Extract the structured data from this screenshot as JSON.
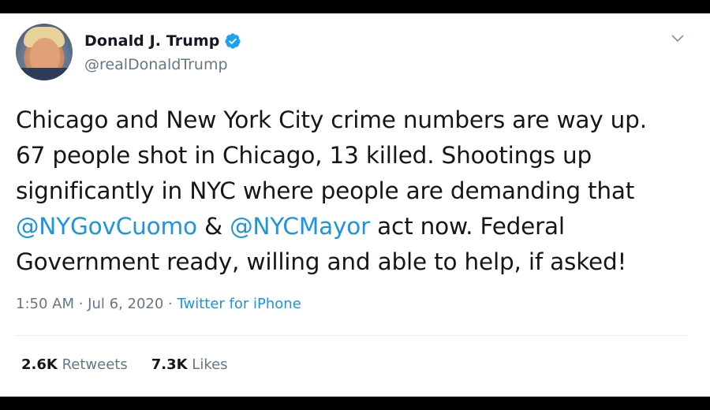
{
  "tweet": {
    "author": {
      "name": "Donald J. Trump",
      "handle": "@realDonaldTrump"
    },
    "text": {
      "line1": "Chicago and New York City crime numbers are way up.",
      "line2": "67 people shot in Chicago, 13 killed. Shootings up",
      "line3": "significantly in NYC where people are demanding that",
      "mention1": "@NYGovCuomo",
      "amp": " & ",
      "mention2": "@NYCMayor",
      "line4_rest": " act now. Federal",
      "line5": "Government ready, willing and able to help, if asked!"
    },
    "meta": {
      "time": "1:50 AM",
      "sep1": " · ",
      "date": "Jul 6, 2020",
      "sep2": " · ",
      "source": "Twitter for iPhone"
    },
    "stats": {
      "retweets_count": "2.6K",
      "retweets_label": "Retweets",
      "likes_count": "7.3K",
      "likes_label": "Likes"
    },
    "icons": {
      "verified": "verified-badge-icon",
      "menu": "chevron-down-icon"
    },
    "colors": {
      "link": "#1b95e0",
      "muted": "#657786",
      "text": "#14171a"
    }
  }
}
